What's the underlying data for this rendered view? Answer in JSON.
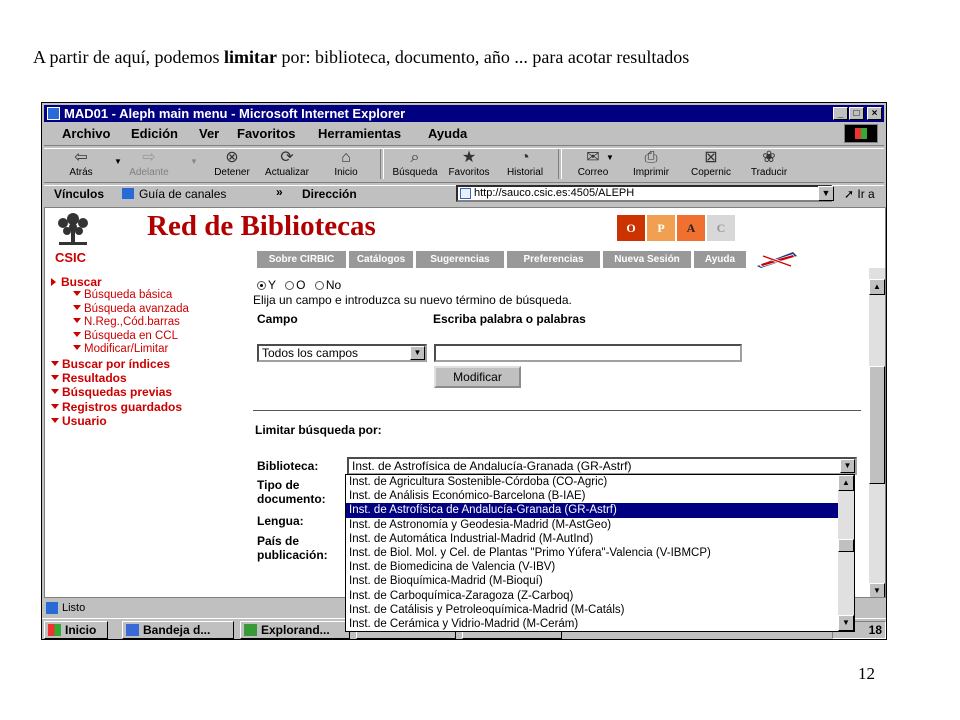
{
  "caption": {
    "part1": "A partir de aquí, podemos ",
    "bold": "limitar",
    "part2": " por: biblioteca, documento, año ...  para acotar resultados"
  },
  "page_number": "12",
  "window": {
    "title": "MAD01 - Aleph main menu - Microsoft Internet Explorer",
    "controls": [
      "_",
      "□",
      "×"
    ]
  },
  "menubar": {
    "archivo": "Archivo",
    "edicion": "Edición",
    "ver": "Ver",
    "favoritos": "Favoritos",
    "herramientas": "Herramientas",
    "ayuda": "Ayuda"
  },
  "toolbar": {
    "atras": "Atrás",
    "adelante": "Adelante",
    "detener": "Detener",
    "actualizar": "Actualizar",
    "inicio": "Inicio",
    "busqueda": "Búsqueda",
    "favoritos": "Favoritos",
    "historial": "Historial",
    "correo": "Correo",
    "imprimir": "Imprimir",
    "copernic": "Copernic",
    "traducir": "Traducir"
  },
  "linksbar": {
    "vinculos": "Vínculos",
    "guia": "Guía de canales",
    "direccion": "Dirección",
    "url": "http://sauco.csic.es:4505/ALEPH",
    "ir": "Ir a",
    "chevron": "»"
  },
  "site": {
    "csic": "CSIC",
    "title": "Red de Bibliotecas",
    "opac": [
      "O",
      "P",
      "A",
      "C"
    ],
    "opac_colors": [
      "#cc3300",
      "#f0a050",
      "#f07030",
      "#d8d8d8"
    ],
    "tabs": [
      "Sobre CIRBIC",
      "Catálogos",
      "Sugerencias",
      "Preferencias",
      "Nueva Sesión",
      "Ayuda"
    ]
  },
  "sidebar": {
    "buscar": "Buscar",
    "busqueda_basica": "Búsqueda básica",
    "busqueda_avanzada": "Búsqueda avanzada",
    "nreg": "N.Reg.,Cód.barras",
    "busqueda_ccl": "Búsqueda en CCL",
    "modificar_limitar": "Modificar/Limitar",
    "buscar_indices": "Buscar por índices",
    "resultados": "Resultados",
    "busquedas_previas": "Búsquedas previas",
    "registros_guardados": "Registros guardados",
    "usuario": "Usuario"
  },
  "form": {
    "radio_y": "Y",
    "radio_o": "O",
    "radio_no": "No",
    "instruction": "Elija un campo e introduzca su nuevo término de búsqueda.",
    "campo": "Campo",
    "escriba": "Escriba palabra o palabras",
    "campo_value": "Todos los campos",
    "search_value": "",
    "modificar": "Modificar",
    "limitar_title": "Limitar búsqueda por:",
    "biblioteca_label": "Biblioteca:",
    "biblioteca_value": "Inst. de Astrofísica de Andalucía-Granada (GR-Astrf)",
    "tipo1": "Tipo de",
    "tipo2": "documento:",
    "lengua": "Lengua:",
    "pais1": "País de",
    "pais2": "publicación:"
  },
  "dropdown_options": [
    "Inst. de Agricultura Sostenible-Córdoba (CO-Agric)",
    "Inst. de Análisis Económico-Barcelona (B-IAE)",
    "Inst. de Astrofísica de Andalucía-Granada (GR-Astrf)",
    "Inst. de Astronomía y Geodesia-Madrid (M-AstGeo)",
    "Inst. de Automática Industrial-Madrid (M-AutInd)",
    "Inst. de Biol. Mol. y Cel. de Plantas \"Primo Yúfera\"-Valencia (V-IBMCP)",
    "Inst. de Biomedicina de Valencia (V-IBV)",
    "Inst. de Bioquímica-Madrid (M-Bioquí)",
    "Inst. de Carboquímica-Zaragoza (Z-Carboq)",
    "Inst. de Catálisis y Petroleoquímica-Madrid (M-Catáls)",
    "Inst. de Cerámica y Vidrio-Madrid (M-Cerám)"
  ],
  "dropdown_selected_index": 2,
  "status": {
    "text": "Listo"
  },
  "taskbar": {
    "inicio": "Inicio",
    "bandeja": "Bandeja d...",
    "explorando": "Explorand...",
    "clock": "18"
  }
}
